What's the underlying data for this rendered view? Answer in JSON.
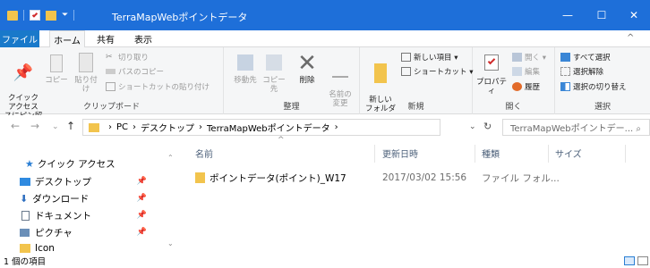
{
  "window": {
    "title": "TerraMapWebポイントデータ",
    "minimize": "—",
    "maximize": "☐",
    "close": "✕"
  },
  "tabs": {
    "file": "ファイル",
    "home": "ホーム",
    "share": "共有",
    "view": "表示"
  },
  "ribbon": {
    "clipboard": {
      "label": "クリップボード",
      "pin": "クイック アクセス\nスにピン留め",
      "copy": "コピー",
      "paste": "貼り付け",
      "cut": "切り取り",
      "copy_path": "パスのコピー",
      "paste_shortcut": "ショートカットの貼り付け"
    },
    "organize": {
      "label": "整理",
      "move_to": "移動先",
      "copy_to": "コピー先",
      "delete": "削除",
      "rename": "名前の\n変更"
    },
    "new": {
      "label": "新規",
      "new_folder": "新しい\nフォルダー",
      "new_item": "新しい項目 ▾",
      "shortcut": "ショートカット ▾"
    },
    "open": {
      "label": "開く",
      "properties": "プロパティ",
      "open": "開く ▾",
      "edit": "編集",
      "history": "履歴"
    },
    "select": {
      "label": "選択",
      "select_all": "すべて選択",
      "select_none": "選択解除",
      "invert": "選択の切り替え"
    }
  },
  "address": {
    "crumbs": [
      "PC",
      "デスクトップ",
      "TerraMapWebポイントデータ"
    ],
    "search_placeholder": "TerraMapWebポイントデー... ⌕"
  },
  "nav": {
    "items": [
      {
        "label": "クイック アクセス",
        "icon": "star-icon",
        "pinned": false
      },
      {
        "label": "デスクトップ",
        "icon": "desktop-icon",
        "pinned": true
      },
      {
        "label": "ダウンロード",
        "icon": "download-icon",
        "pinned": true
      },
      {
        "label": "ドキュメント",
        "icon": "document-icon",
        "pinned": true
      },
      {
        "label": "ピクチャ",
        "icon": "picture-icon",
        "pinned": true
      },
      {
        "label": "Icon",
        "icon": "folder-icon",
        "pinned": false
      }
    ]
  },
  "columns": {
    "name": "名前",
    "date": "更新日時",
    "type": "種類",
    "size": "サイズ"
  },
  "files": [
    {
      "name": "ポイントデータ(ポイント)_W17",
      "date": "2017/03/02 15:56",
      "type": "ファイル フォル..."
    }
  ],
  "status": {
    "count": "1 個の項目"
  },
  "colors": {
    "titlebar": "#1e6fd9",
    "folder": "#f2c44d",
    "accent": "#1979ca"
  }
}
